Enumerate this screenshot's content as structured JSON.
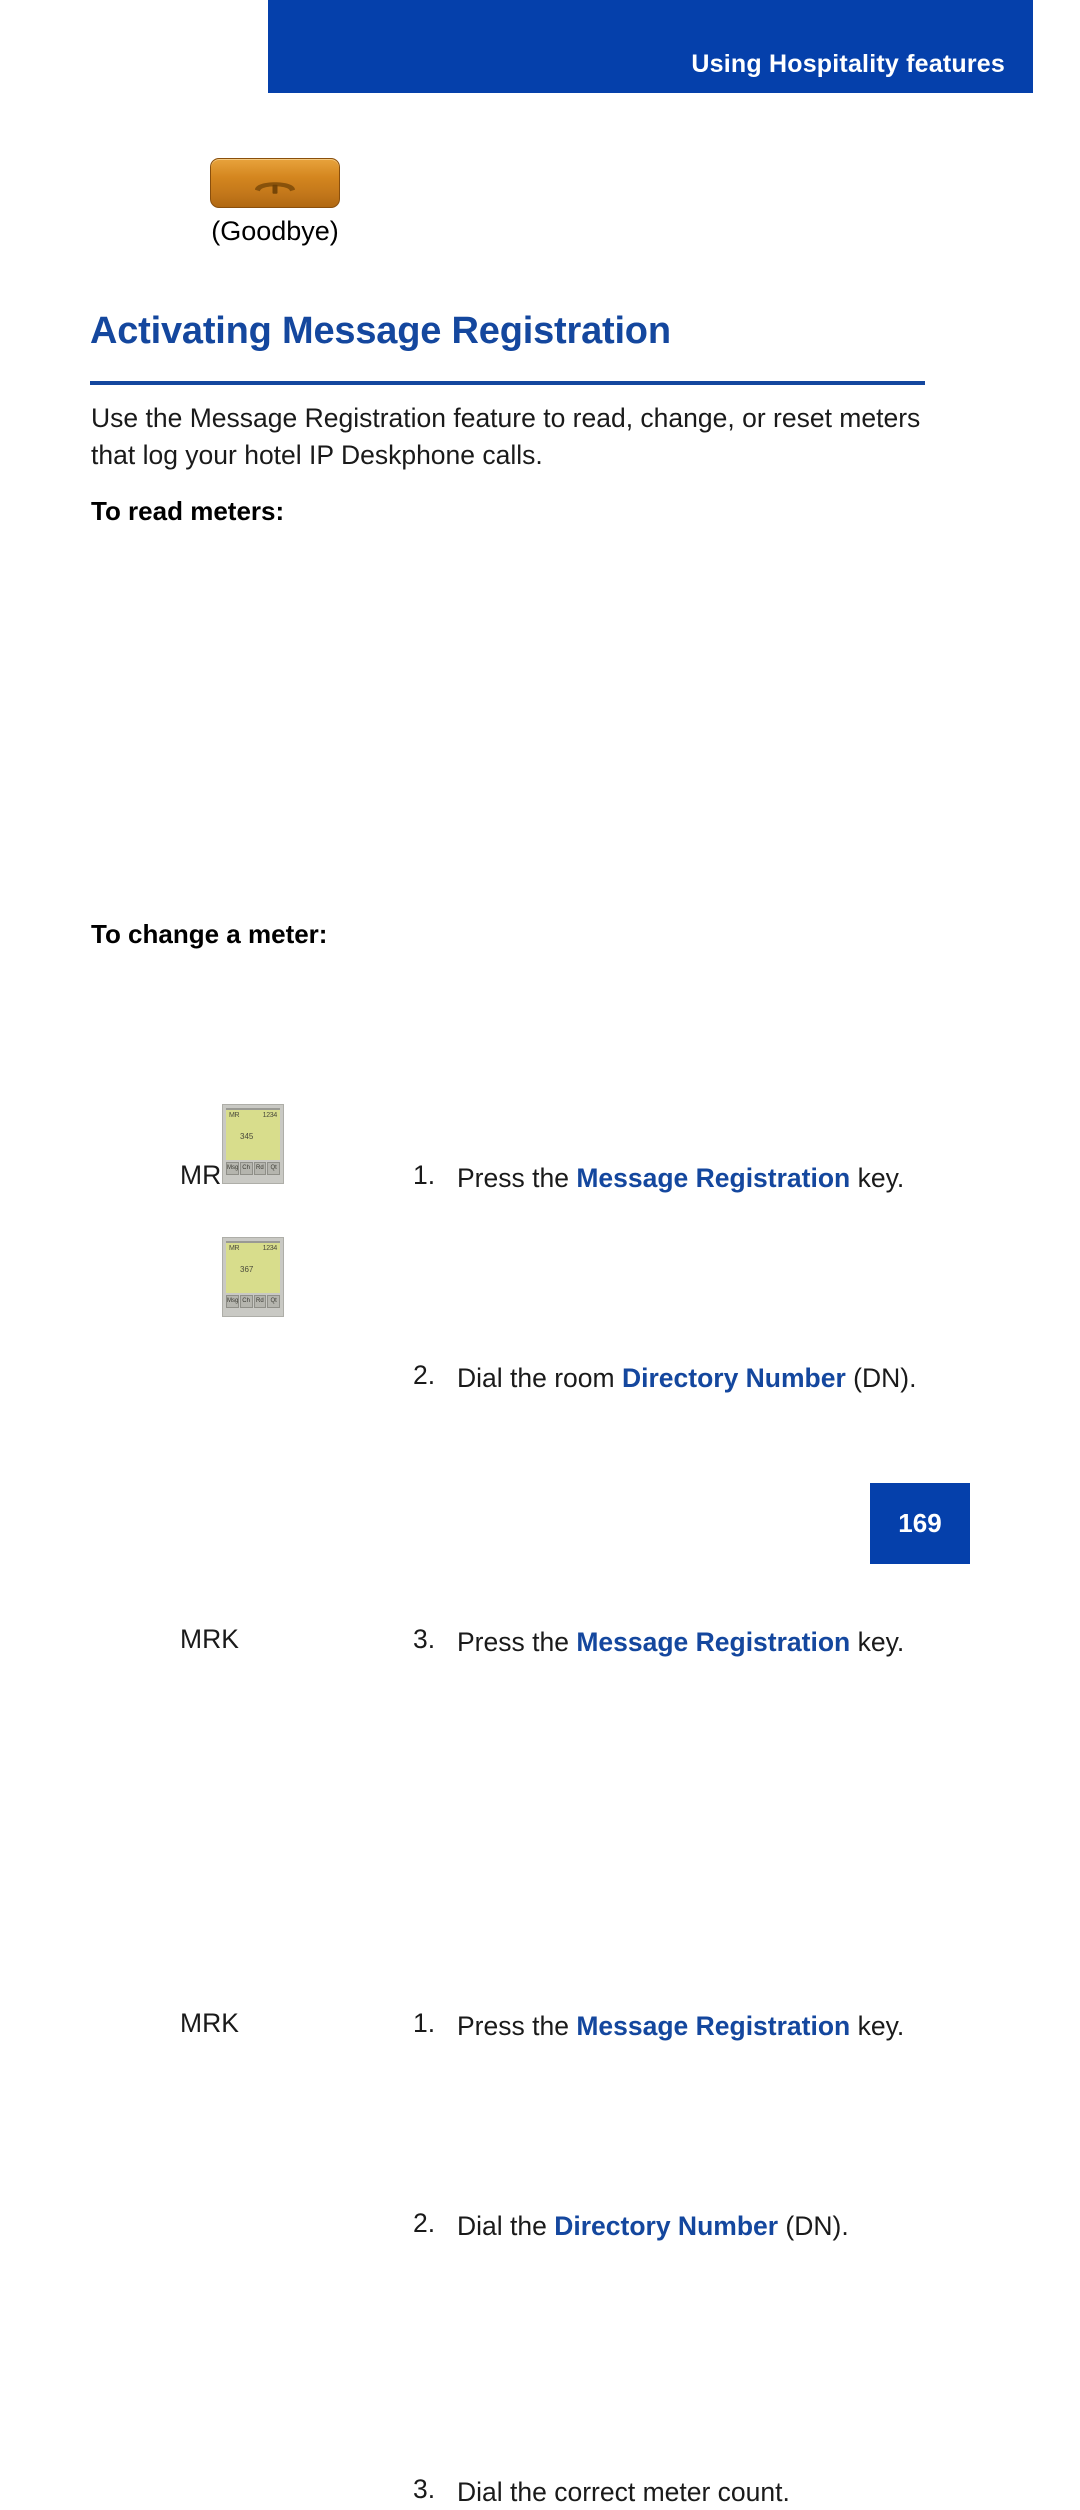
{
  "header": {
    "title": "Using Hospitality features",
    "bar_color": "#0540ab"
  },
  "goodbye_block": {
    "caption": "(Goodbye)",
    "key_color": "#cc7a1e",
    "icon": "telephone-handset-icon"
  },
  "section": {
    "title": "Activating Message Registration",
    "title_color": "#14479e",
    "intro": "Use the Message Registration feature to read, change, or reset meters that log your hotel IP Deskphone calls."
  },
  "read_meters": {
    "heading": "To read meters:",
    "steps": [
      {
        "key_label": "MRK",
        "number": "1.",
        "text_before": "Press the ",
        "text_bold": "Message Registration",
        "text_after": " key."
      },
      {
        "key_label": "",
        "number": "2.",
        "text_before": "Dial the room ",
        "text_bold": "Directory Number",
        "text_after": " (DN)."
      },
      {
        "key_label": "MRK",
        "number": "3.",
        "text_before": "Press the ",
        "text_bold": "Message Registration",
        "text_after": " key."
      }
    ]
  },
  "change_meter": {
    "heading": "To change a meter:",
    "steps": [
      {
        "key_label": "MRK",
        "number": "1.",
        "text_before": "Press the ",
        "text_bold": "Message Registration",
        "text_after": " key."
      },
      {
        "key_label": "",
        "number": "2.",
        "text_before": "Dial the ",
        "text_bold": "Directory Number",
        "text_after": " (DN)."
      },
      {
        "key_label": "",
        "number": "3.",
        "text_before": "Dial the correct meter count.",
        "text_bold": "",
        "text_after": ""
      }
    ]
  },
  "display_icons": [
    {
      "lcd_top_left": "MR",
      "lcd_top_right": "1234",
      "lcd_value": "345",
      "softkeys": [
        "Msg",
        "Ch",
        "Rd",
        "Qt"
      ]
    },
    {
      "lcd_top_left": "MR",
      "lcd_top_right": "1234",
      "lcd_value": "367",
      "softkeys": [
        "Msg",
        "Ch",
        "Rd",
        "Qt"
      ]
    }
  ],
  "footer": {
    "page_number": "169"
  }
}
